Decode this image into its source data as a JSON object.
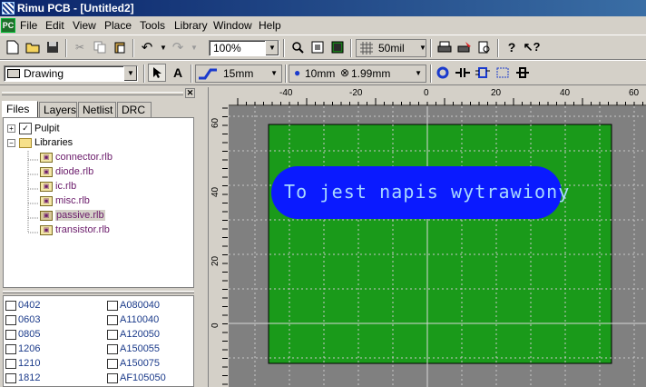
{
  "window": {
    "title": "Rimu PCB - [Untitled2]"
  },
  "menu": [
    "File",
    "Edit",
    "View",
    "Place",
    "Tools",
    "Library",
    "Window",
    "Help"
  ],
  "toolbar1": {
    "zoom": "100%",
    "grid": "50mil"
  },
  "toolbar2": {
    "layer": "Drawing",
    "track_width": "15mm",
    "pad_size": "10mm",
    "hole_size": "1.99mm"
  },
  "panel": {
    "tabs": [
      "Files",
      "Layers",
      "Netlist",
      "DRC"
    ],
    "tree": {
      "root": "Pulpit",
      "folder": "Libraries",
      "libraries": [
        "connector.rlb",
        "diode.rlb",
        "ic.rlb",
        "misc.rlb",
        "passive.rlb",
        "transistor.rlb"
      ],
      "selected": "passive.rlb"
    },
    "components": {
      "col1": [
        "0402",
        "0603",
        "0805",
        "1206",
        "1210",
        "1812"
      ],
      "col2": [
        "A080040",
        "A110040",
        "A120050",
        "A150055",
        "A150075",
        "AF105050"
      ]
    }
  },
  "canvas": {
    "x_ticks": [
      "-40",
      "-20",
      "0",
      "20",
      "40",
      "60"
    ],
    "y_ticks": [
      "60",
      "40",
      "20",
      "0"
    ],
    "label_text": "To jest napis wytrawiony",
    "colors": {
      "board": "#1a9a1a",
      "outer": "#808080",
      "label_fill": "#0a1aff",
      "label_text": "#a8d8ff"
    }
  }
}
